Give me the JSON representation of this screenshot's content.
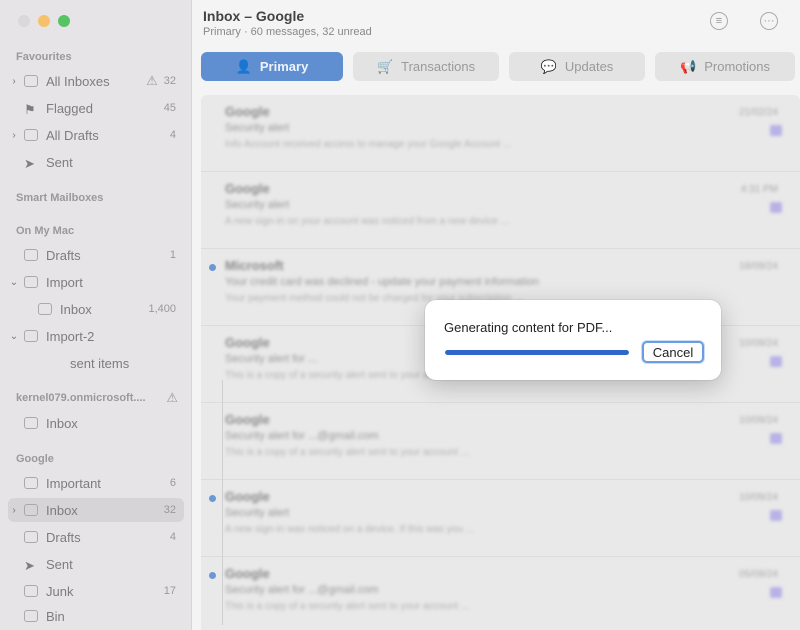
{
  "window": {
    "title": "Inbox – Google",
    "subtitle": "Primary · 60 messages, 32 unread"
  },
  "colors": {
    "accent": "#5f8fd1",
    "progress": "#2f66c9",
    "unread_dot": "#6c97d6"
  },
  "sidebar": {
    "favourites_title": "Favourites",
    "favourites": [
      {
        "label": "All Inboxes",
        "count": "32",
        "icon": "tray-stack-icon",
        "warn": true,
        "chevron": true
      },
      {
        "label": "Flagged",
        "count": "45",
        "icon": "flag-icon",
        "warn": false,
        "chevron": false
      },
      {
        "label": "All Drafts",
        "count": "4",
        "icon": "document-icon",
        "warn": false,
        "chevron": true
      },
      {
        "label": "Sent",
        "count": "",
        "icon": "paperplane-icon",
        "warn": false,
        "chevron": false
      }
    ],
    "smart_mailboxes_title": "Smart Mailboxes",
    "on_my_mac_title": "On My Mac",
    "on_my_mac": [
      {
        "label": "Drafts",
        "count": "1"
      },
      {
        "label": "Import",
        "count": ""
      },
      {
        "label": "Inbox",
        "count": "1,400"
      },
      {
        "label": "Import-2",
        "count": ""
      },
      {
        "label": "sent items",
        "count": ""
      }
    ],
    "account_title": "kernel079.onmicrosoft....",
    "account_items": [
      {
        "label": "Inbox",
        "count": ""
      }
    ],
    "google_title": "Google",
    "google_items": [
      {
        "label": "Important",
        "count": "6"
      },
      {
        "label": "Inbox",
        "count": "32"
      },
      {
        "label": "Drafts",
        "count": "4"
      },
      {
        "label": "Sent",
        "count": ""
      },
      {
        "label": "Junk",
        "count": "17"
      },
      {
        "label": "Bin",
        "count": ""
      }
    ]
  },
  "tabs": [
    {
      "label": "Primary",
      "icon": "person-icon"
    },
    {
      "label": "Transactions",
      "icon": "cart-icon"
    },
    {
      "label": "Updates",
      "icon": "message-icon"
    },
    {
      "label": "Promotions",
      "icon": "megaphone-icon"
    }
  ],
  "messages": [
    {
      "sender": "Google",
      "subject": "Security alert",
      "date": "21/02/24",
      "preview": "Info Account received access to manage your Google Account ...",
      "unread": false
    },
    {
      "sender": "Google",
      "subject": "Security alert",
      "date": "4:31 PM",
      "preview": "A new sign-in on your account was noticed from a new device ...",
      "unread": false
    },
    {
      "sender": "Microsoft",
      "subject": "Your credit card was declined - update your payment information",
      "date": "18/09/24",
      "preview": "Your payment method could not be charged for your subscription ...",
      "unread": true
    },
    {
      "sender": "Google",
      "subject": "Security alert for ...",
      "date": "10/09/24",
      "preview": "This is a copy of a security alert sent to your account ...",
      "unread": false
    },
    {
      "sender": "Google",
      "subject": "Security alert for ...@gmail.com",
      "date": "10/09/24",
      "preview": "This is a copy of a security alert sent to your account ...",
      "unread": false
    },
    {
      "sender": "Google",
      "subject": "Security alert",
      "date": "10/09/24",
      "preview": "A new sign-in was noticed on a device. If this was you ...",
      "unread": true
    },
    {
      "sender": "Google",
      "subject": "Security alert for ...@gmail.com",
      "date": "05/09/24",
      "preview": "This is a copy of a security alert sent to your account ...",
      "unread": true
    }
  ],
  "dialog": {
    "title": "Generating content for PDF...",
    "progress_fraction": 1.0,
    "cancel_label": "Cancel"
  }
}
